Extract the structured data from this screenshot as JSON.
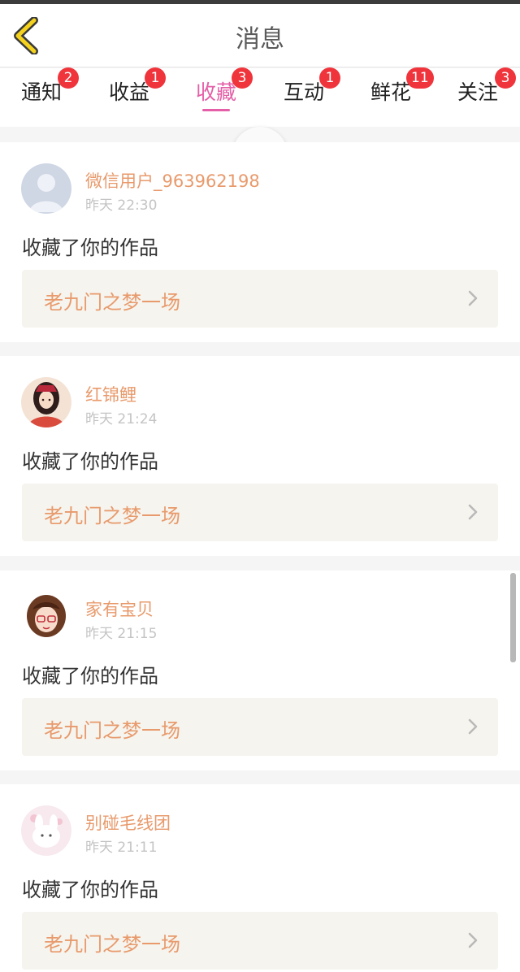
{
  "header": {
    "title": "消息"
  },
  "tabs": [
    {
      "label": "通知",
      "badge": "2"
    },
    {
      "label": "收益",
      "badge": "1"
    },
    {
      "label": "收藏",
      "badge": "3",
      "active": true
    },
    {
      "label": "互动",
      "badge": "1"
    },
    {
      "label": "鲜花",
      "badge": "11"
    },
    {
      "label": "关注",
      "badge": "3"
    }
  ],
  "messages": [
    {
      "user": "微信用户_963962198",
      "time": "昨天 22:30",
      "action": "收藏了你的作品",
      "work": "老九门之梦一场",
      "avatar": "default-avatar-icon"
    },
    {
      "user": "红锦鲤",
      "time": "昨天 21:24",
      "action": "收藏了你的作品",
      "work": "老九门之梦一场",
      "avatar": "girl-avatar-icon"
    },
    {
      "user": "家有宝贝",
      "time": "昨天 21:15",
      "action": "收藏了你的作品",
      "work": "老九门之梦一场",
      "avatar": "glasses-girl-avatar-icon"
    },
    {
      "user": "别碰毛线团",
      "time": "昨天 21:11",
      "action": "收藏了你的作品",
      "work": "老九门之梦一场",
      "avatar": "cartoon-bunny-avatar-icon"
    }
  ],
  "colors": {
    "accent": "#e45fa7",
    "badge": "#f0343c",
    "username": "#e89a6c",
    "work_box": "#f5f4ee",
    "back_icon": "#f4d21e"
  }
}
